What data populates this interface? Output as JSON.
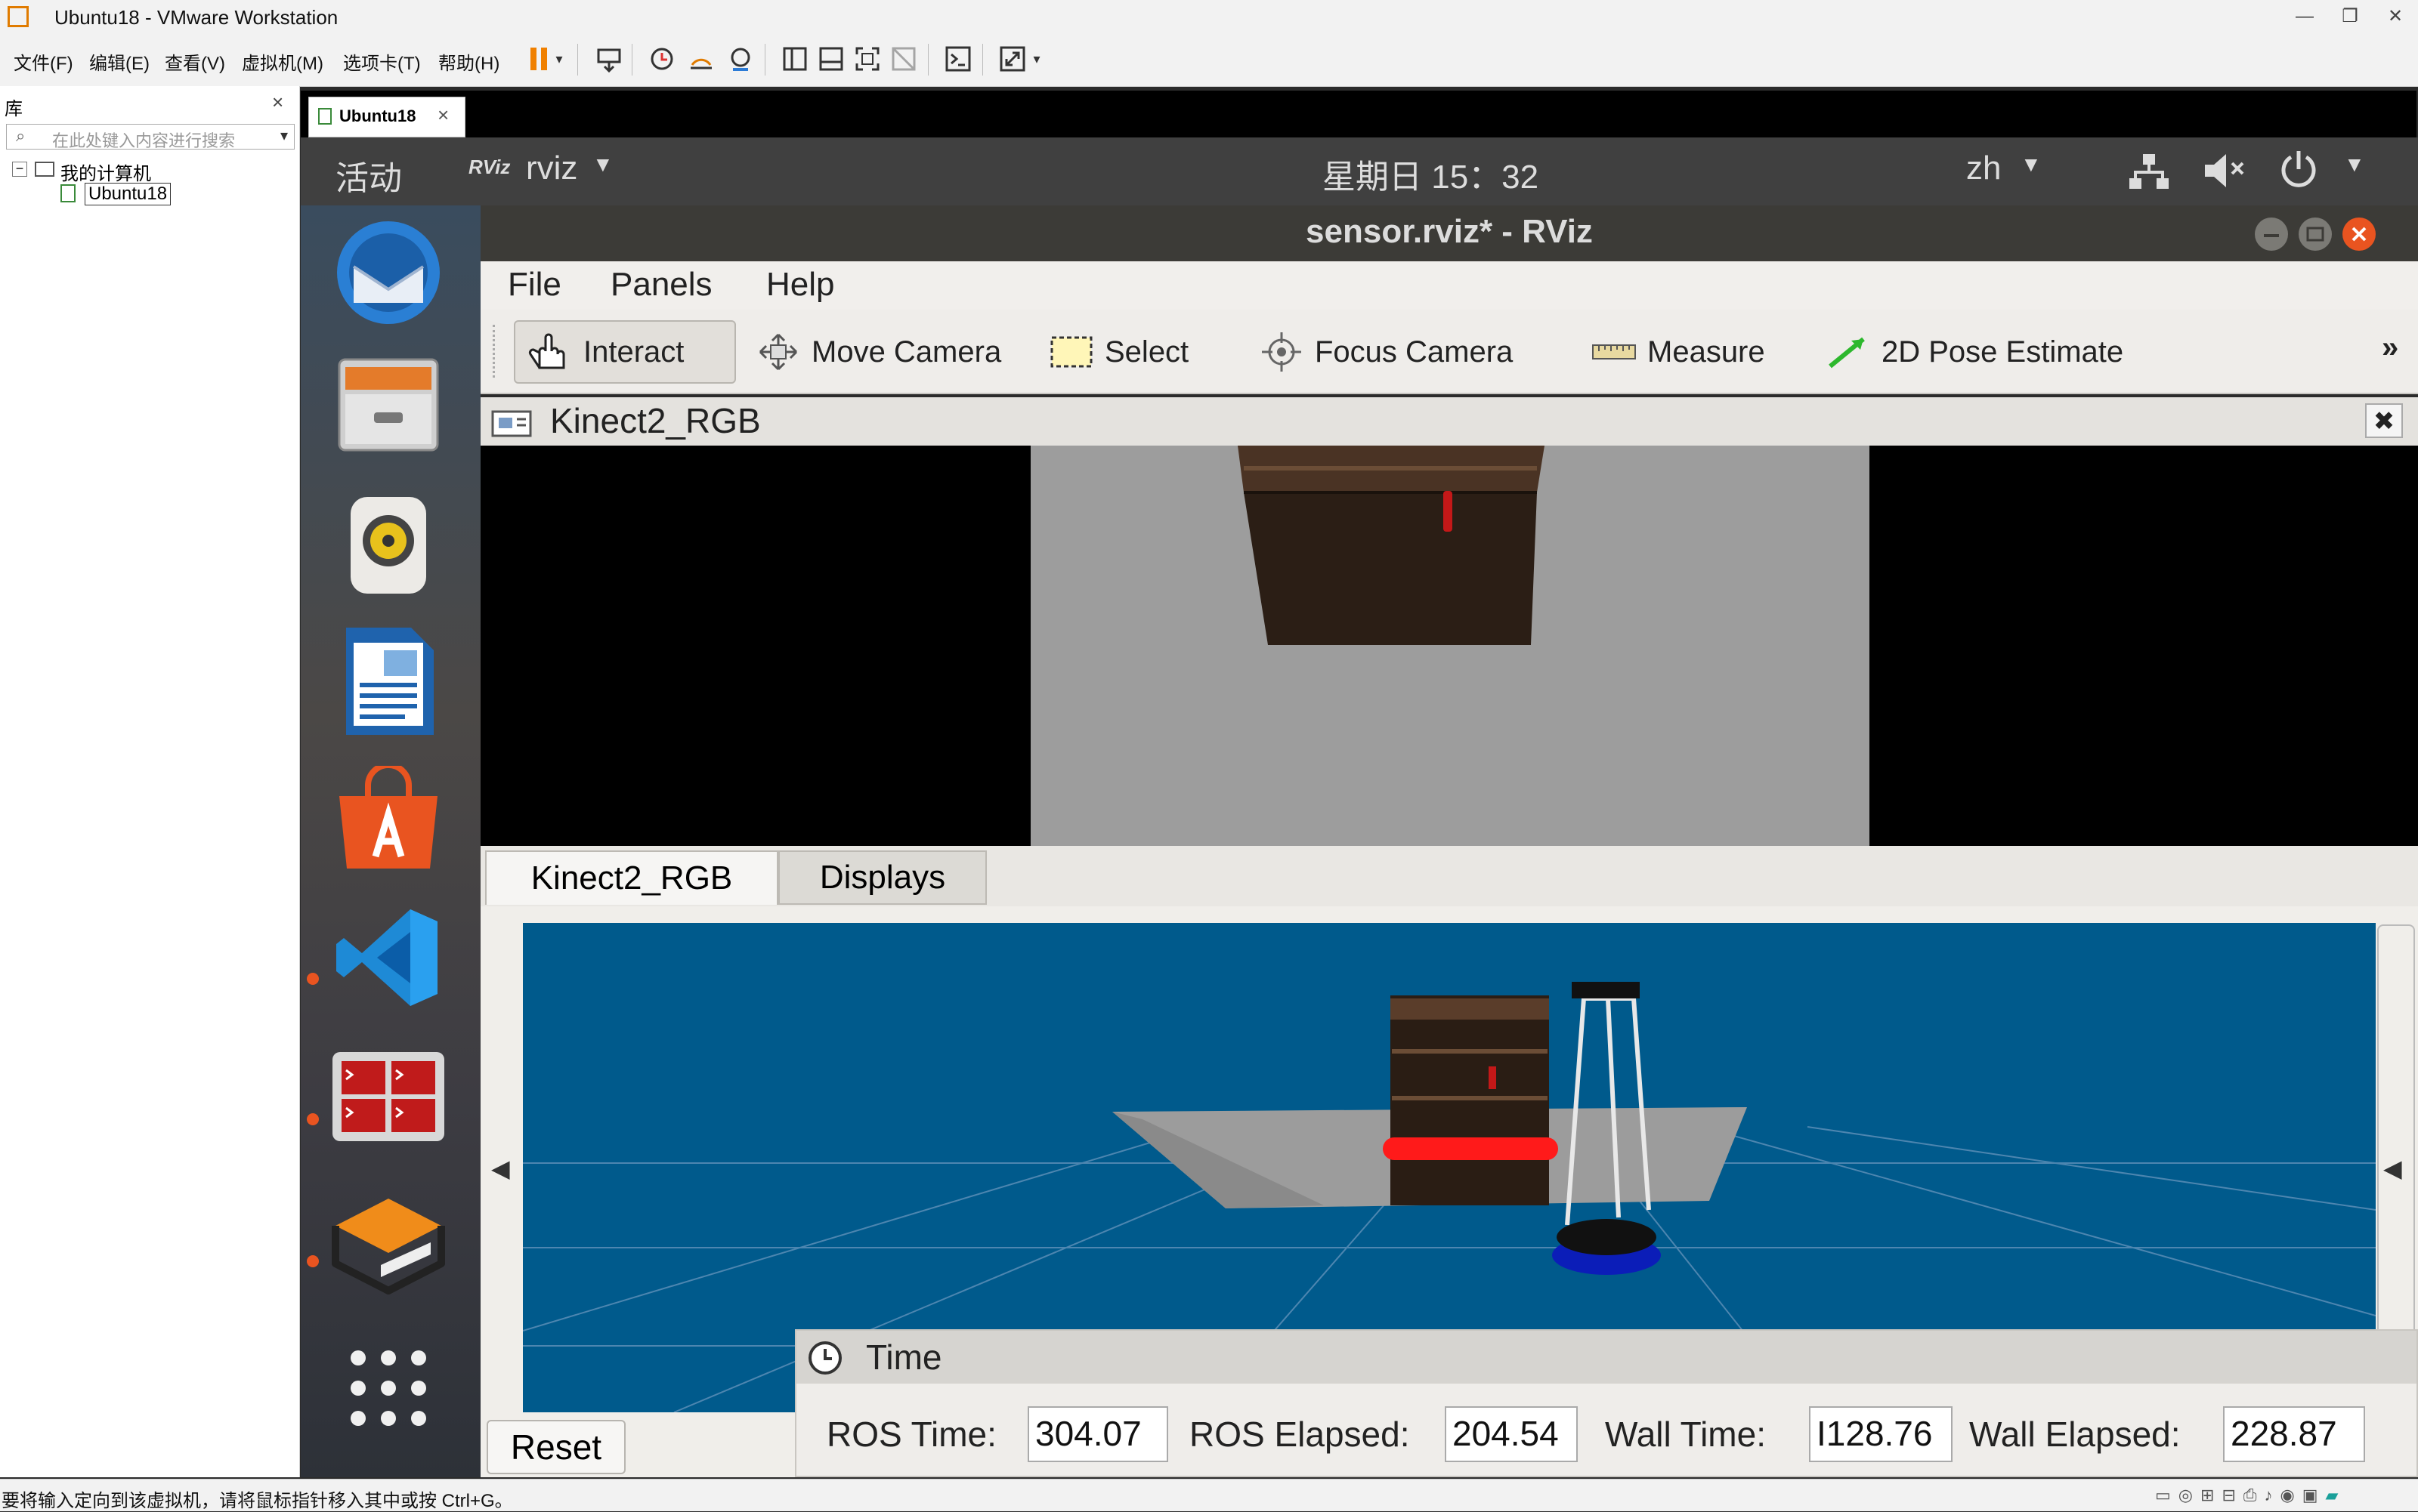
{
  "vmware": {
    "window_title": "Ubuntu18 - VMware Workstation",
    "menus": [
      "文件(F)",
      "编辑(E)",
      "查看(V)",
      "虚拟机(M)",
      "选项卡(T)",
      "帮助(H)"
    ],
    "library": {
      "title": "库",
      "search_placeholder": "在此处键入内容进行搜索",
      "tree_root": "我的计算机",
      "tree_child": "Ubuntu18"
    },
    "tab_label": "Ubuntu18",
    "status_text": "要将输入定向到该虚拟机，请将鼠标指针移入其中或按 Ctrl+G。"
  },
  "ubuntu_panel": {
    "activities": "活动",
    "app_name": "rviz",
    "app_icon_text": "RViz",
    "clock": "星期日 15：32",
    "input_method": "zh"
  },
  "dock": {
    "items": [
      {
        "name": "thunderbird-icon"
      },
      {
        "name": "files-icon"
      },
      {
        "name": "rhythmbox-icon"
      },
      {
        "name": "libreoffice-writer-icon"
      },
      {
        "name": "software-center-icon"
      },
      {
        "name": "vscode-icon"
      },
      {
        "name": "terminator-icon"
      },
      {
        "name": "sublime-merge-icon"
      },
      {
        "name": "show-apps-icon"
      }
    ]
  },
  "rviz": {
    "window_title": "sensor.rviz* - RViz",
    "menu": {
      "file": "File",
      "panels": "Panels",
      "help": "Help"
    },
    "tools": {
      "interact": "Interact",
      "move_camera": "Move Camera",
      "select": "Select",
      "focus_camera": "Focus Camera",
      "measure": "Measure",
      "pose_estimate": "2D Pose Estimate",
      "overflow": "»"
    },
    "image_panel_title": "Kinect2_RGB",
    "tabs": {
      "kinect": "Kinect2_RGB",
      "displays": "Displays"
    },
    "reset_label": "Reset",
    "time": {
      "title": "Time",
      "ros_time_label": "ROS Time:",
      "ros_time_value": "304.07",
      "ros_elapsed_label": "ROS Elapsed:",
      "ros_elapsed_value": "204.54",
      "wall_time_label": "Wall Time:",
      "wall_time_value": "I128.76",
      "wall_elapsed_label": "Wall Elapsed:",
      "wall_elapsed_value": "228.87"
    }
  },
  "colors": {
    "viewport_bg": "#005a8c",
    "ubuntu_orange": "#e95420",
    "panel_dark": "#404040",
    "rviz_title_bg": "#3c3b37"
  }
}
